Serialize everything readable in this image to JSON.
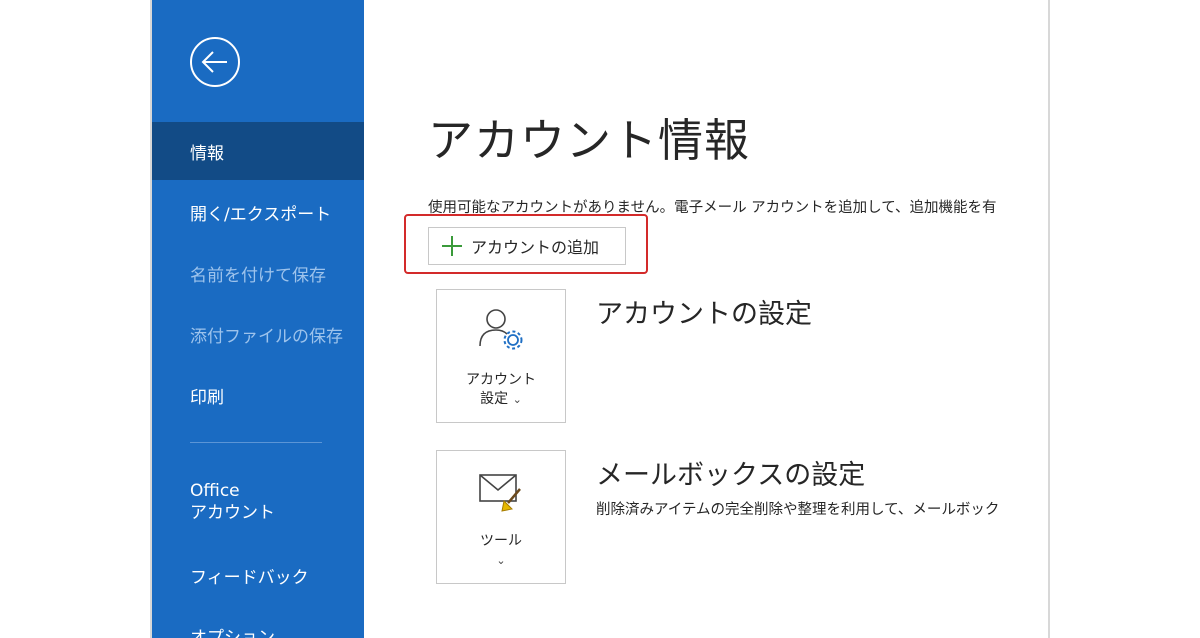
{
  "sidebar": {
    "back_icon": "back-arrow-circle-icon",
    "items": [
      {
        "label": "情報",
        "state": "active"
      },
      {
        "label": "開く/エクスポート",
        "state": "normal"
      },
      {
        "label": "名前を付けて保存",
        "state": "disabled"
      },
      {
        "label": "添付ファイルの保存",
        "state": "disabled"
      },
      {
        "label": "印刷",
        "state": "normal"
      },
      {
        "label": "Office\nアカウント",
        "state": "normal"
      },
      {
        "label": "フィードバック",
        "state": "normal"
      },
      {
        "label": "オプション",
        "state": "normal"
      }
    ]
  },
  "main": {
    "title": "アカウント情報",
    "info_text": "使用可能なアカウントがありません。電子メール アカウントを追加して、追加機能を有",
    "add_account_label": "アカウントの追加",
    "account_settings": {
      "title": "アカウントの設定",
      "tile_label": "アカウント\n設定",
      "tile_chevron": "⌄",
      "icon": "person-gear-icon"
    },
    "mailbox_settings": {
      "title": "メールボックスの設定",
      "description": "削除済みアイテムの完全削除や整理を利用して、メールボック",
      "tile_label": "ツール",
      "tile_chevron": "⌄",
      "icon": "envelope-broom-icon"
    }
  },
  "colors": {
    "sidebar_bg": "#1a6bc2",
    "sidebar_active": "#124b86",
    "highlight": "#d32a2a",
    "plus": "#3a9a3a"
  }
}
